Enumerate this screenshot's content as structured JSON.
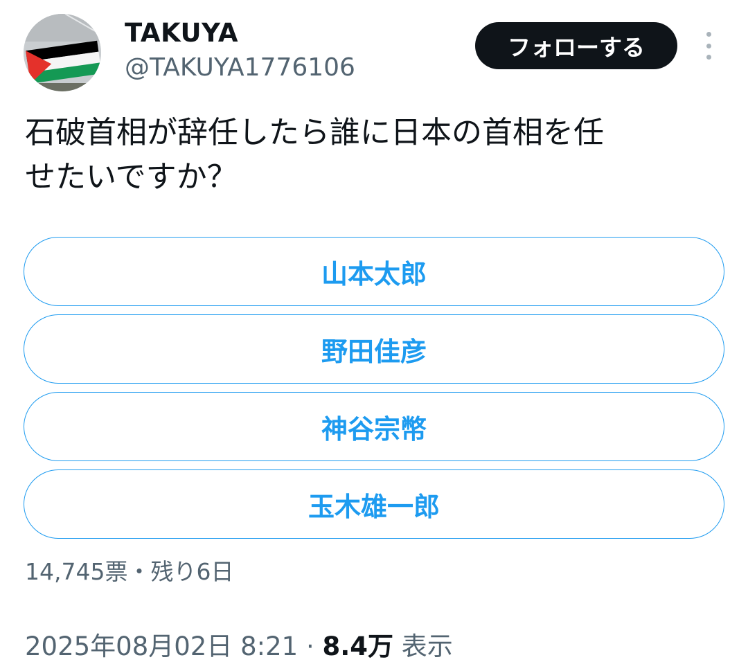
{
  "user": {
    "display_name": "TAKUYA",
    "handle": "@TAKUYA1776106",
    "avatar_flag_colors": [
      "#000000",
      "#ffffff",
      "#149954",
      "#e4312b"
    ]
  },
  "actions": {
    "follow_label": "フォローする",
    "more_icon": "more-vertical-icon"
  },
  "tweet": {
    "text": "石破首相が辞任したら誰に日本の首相を任\nせたいですか？"
  },
  "poll": {
    "options": [
      "山本太郎",
      "野田佳彦",
      "神谷宗幣",
      "玉木雄一郎"
    ],
    "votes": "14,745票",
    "separator": "・",
    "remaining": "残り6日"
  },
  "meta": {
    "date": "2025年08月02日",
    "time": "8:21",
    "separator": "·",
    "views_count": "8.4万",
    "views_label": "表示"
  },
  "colors": {
    "accent": "#1d9bf0",
    "text": "#0f1419",
    "secondary": "#536471",
    "button_bg": "#0f1419"
  }
}
